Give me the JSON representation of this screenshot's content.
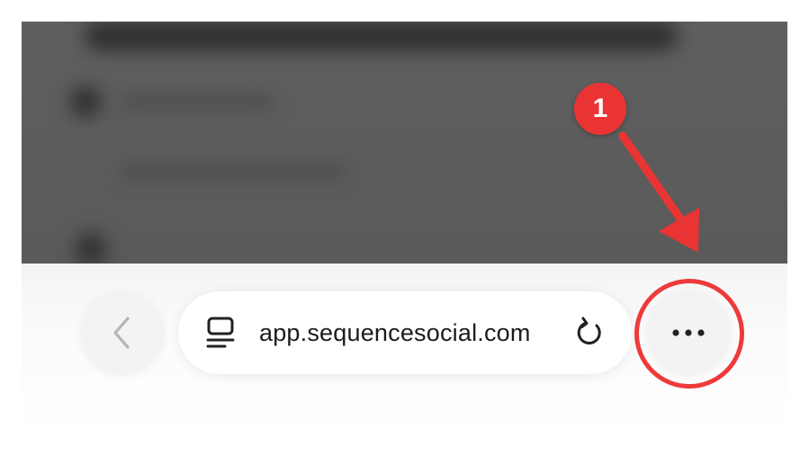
{
  "browser": {
    "url": "app.sequencesocial.com",
    "back_icon": "chevron-left-icon",
    "tab_icon": "tabs-list-icon",
    "reload_icon": "reload-icon",
    "more_icon": "more-dots-icon"
  },
  "annotation": {
    "step_number": "1",
    "color": "#ea3434"
  }
}
